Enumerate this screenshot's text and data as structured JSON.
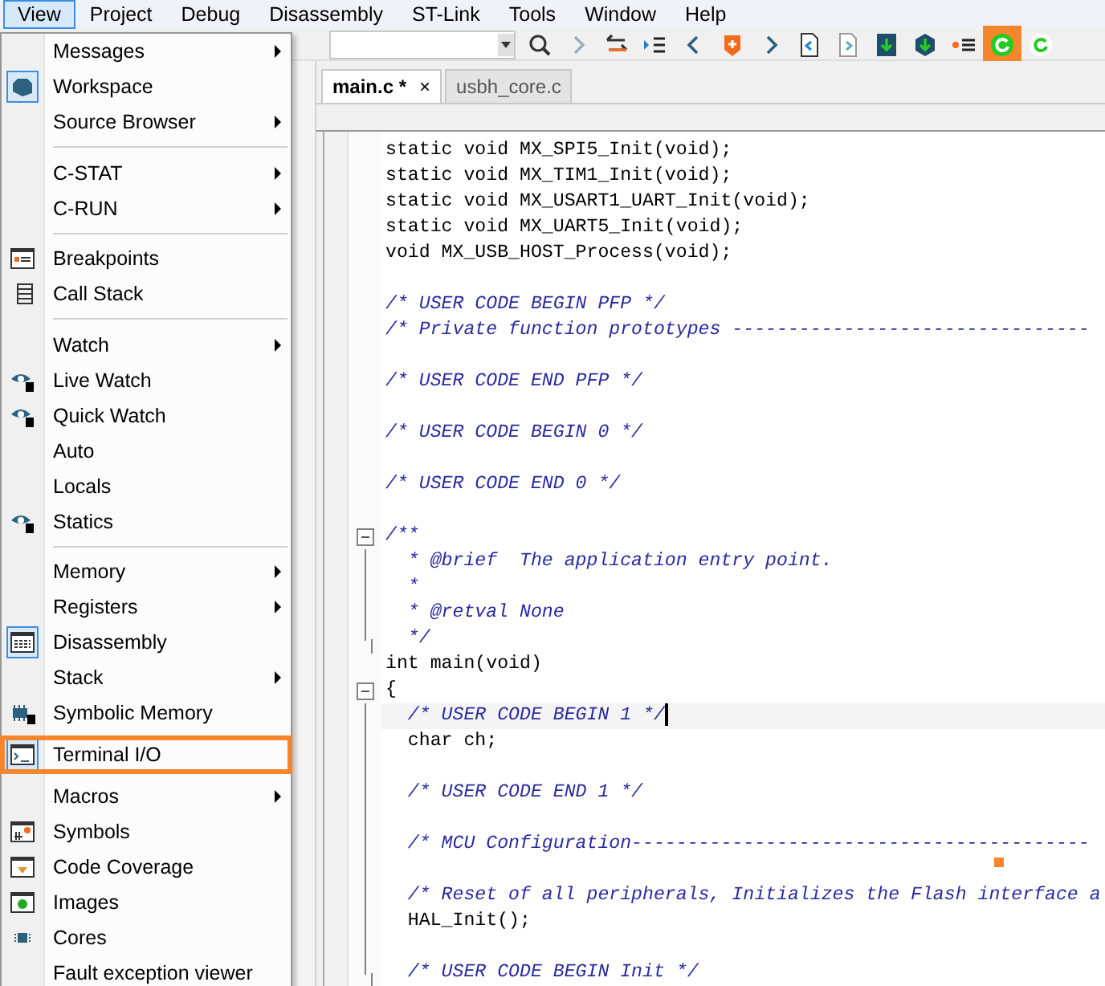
{
  "menubar": [
    {
      "label": "View",
      "selected": true
    },
    {
      "label": "Project",
      "selected": false
    },
    {
      "label": "Debug",
      "selected": false
    },
    {
      "label": "Disassembly",
      "selected": false
    },
    {
      "label": "ST-Link",
      "selected": false
    },
    {
      "label": "Tools",
      "selected": false
    },
    {
      "label": "Window",
      "selected": false
    },
    {
      "label": "Help",
      "selected": false
    }
  ],
  "toolbar": {
    "buttons": [
      {
        "highlighted": false
      },
      {
        "highlighted": false
      },
      {
        "highlighted": false
      },
      {
        "highlighted": false
      },
      {
        "highlighted": false
      },
      {
        "highlighted": false
      },
      {
        "highlighted": false
      },
      {
        "highlighted": false
      },
      {
        "highlighted": false
      },
      {
        "highlighted": false
      },
      {
        "highlighted": false
      },
      {
        "highlighted": false
      },
      {
        "highlighted": true
      },
      {
        "highlighted": false
      }
    ]
  },
  "tabs": [
    {
      "label": "main.c *",
      "selected": true,
      "close": "×"
    },
    {
      "label": "usbh_core.c",
      "selected": false
    }
  ],
  "code": [
    {
      "text": "static void MX_SPI5_Init(void);",
      "kind": "code",
      "current": false
    },
    {
      "text": "static void MX_TIM1_Init(void);",
      "kind": "code",
      "current": false
    },
    {
      "text": "static void MX_USART1_UART_Init(void);",
      "kind": "code",
      "current": false
    },
    {
      "text": "static void MX_UART5_Init(void);",
      "kind": "code",
      "current": false
    },
    {
      "text": "void MX_USB_HOST_Process(void);",
      "kind": "code",
      "current": false
    },
    {
      "kind": "blank"
    },
    {
      "text": "/* USER CODE BEGIN PFP */",
      "kind": "comment",
      "current": false
    },
    {
      "text": "/* Private function prototypes --------------------------------",
      "kind": "comment",
      "current": false
    },
    {
      "kind": "blank"
    },
    {
      "text": "/* USER CODE END PFP */",
      "kind": "comment",
      "current": false
    },
    {
      "kind": "blank"
    },
    {
      "text": "/* USER CODE BEGIN 0 */",
      "kind": "comment",
      "current": false
    },
    {
      "kind": "blank"
    },
    {
      "text": "/* USER CODE END 0 */",
      "kind": "comment",
      "current": false
    },
    {
      "kind": "blank"
    },
    {
      "text": "/**",
      "kind": "comment",
      "current": false,
      "children": [
        {
          "text": "  * @brief  The application entry point.",
          "kind": "comment",
          "current": false
        },
        {
          "text": "  *",
          "kind": "comment",
          "current": false
        },
        {
          "text": "  * @retval None",
          "kind": "comment",
          "current": false
        },
        {
          "text": "  */",
          "kind": "comment",
          "current": false
        }
      ]
    },
    {
      "text": "int main(void)",
      "kind": "code",
      "current": false
    },
    {
      "text": "{",
      "kind": "code",
      "current": false,
      "children": [
        {
          "text": "  /* USER CODE BEGIN 1 */",
          "kind": "comment",
          "current": true
        },
        {
          "text": "  char ch;",
          "kind": "code",
          "current": false
        },
        {
          "kind": "blank"
        },
        {
          "text": "  /* USER CODE END 1 */",
          "kind": "comment",
          "current": false
        },
        {
          "kind": "blank"
        },
        {
          "text": "  /* MCU Configuration-----------------------------------------",
          "kind": "comment",
          "current": false
        },
        {
          "kind": "blank"
        },
        {
          "text": "  /* Reset of all peripherals, Initializes the Flash interface a",
          "kind": "comment",
          "current": false
        },
        {
          "text": "  HAL_Init();",
          "kind": "code",
          "current": false
        },
        {
          "kind": "blank"
        },
        {
          "text": "  /* USER CODE BEGIN Init */",
          "kind": "comment",
          "current": false
        }
      ]
    }
  ],
  "menu": [
    {
      "kind": "item",
      "label": "Messages",
      "submenu": true,
      "checked": false,
      "highlighted": false
    },
    {
      "kind": "item",
      "label": "Workspace",
      "submenu": false,
      "checked": true,
      "highlighted": false
    },
    {
      "kind": "item",
      "label": "Source Browser",
      "submenu": true,
      "checked": false,
      "highlighted": false
    },
    {
      "kind": "separator"
    },
    {
      "kind": "item",
      "label": "C-STAT",
      "submenu": true,
      "checked": false,
      "highlighted": false
    },
    {
      "kind": "item",
      "label": "C-RUN",
      "submenu": true,
      "checked": false,
      "highlighted": false
    },
    {
      "kind": "separator"
    },
    {
      "kind": "item",
      "label": "Breakpoints",
      "submenu": false,
      "checked": false,
      "highlighted": false
    },
    {
      "kind": "item",
      "label": "Call Stack",
      "submenu": false,
      "checked": false,
      "highlighted": false
    },
    {
      "kind": "separator"
    },
    {
      "kind": "item",
      "label": "Watch",
      "submenu": true,
      "checked": false,
      "highlighted": false
    },
    {
      "kind": "item",
      "label": "Live Watch",
      "submenu": false,
      "checked": false,
      "highlighted": false
    },
    {
      "kind": "item",
      "label": "Quick Watch",
      "submenu": false,
      "checked": false,
      "highlighted": false
    },
    {
      "kind": "item",
      "label": "Auto",
      "submenu": false,
      "checked": false,
      "highlighted": false
    },
    {
      "kind": "item",
      "label": "Locals",
      "submenu": false,
      "checked": false,
      "highlighted": false
    },
    {
      "kind": "item",
      "label": "Statics",
      "submenu": false,
      "checked": false,
      "highlighted": false
    },
    {
      "kind": "separator"
    },
    {
      "kind": "item",
      "label": "Memory",
      "submenu": true,
      "checked": false,
      "highlighted": false
    },
    {
      "kind": "item",
      "label": "Registers",
      "submenu": true,
      "checked": false,
      "highlighted": false
    },
    {
      "kind": "item",
      "label": "Disassembly",
      "submenu": false,
      "checked": true,
      "highlighted": false
    },
    {
      "kind": "item",
      "label": "Stack",
      "submenu": true,
      "checked": false,
      "highlighted": false
    },
    {
      "kind": "item",
      "label": "Symbolic Memory",
      "submenu": false,
      "checked": false,
      "highlighted": false
    },
    {
      "kind": "item",
      "label": "Terminal I/O",
      "submenu": false,
      "checked": true,
      "highlighted": true
    },
    {
      "kind": "item",
      "label": "Macros",
      "submenu": true,
      "checked": false,
      "highlighted": false
    },
    {
      "kind": "item",
      "label": "Symbols",
      "submenu": false,
      "checked": false,
      "highlighted": false
    },
    {
      "kind": "item",
      "label": "Code Coverage",
      "submenu": false,
      "checked": false,
      "highlighted": false
    },
    {
      "kind": "item",
      "label": "Images",
      "submenu": false,
      "checked": false,
      "highlighted": false
    },
    {
      "kind": "item",
      "label": "Cores",
      "submenu": false,
      "checked": false,
      "highlighted": false
    },
    {
      "kind": "item",
      "label": "Fault exception viewer",
      "submenu": false,
      "checked": false,
      "highlighted": false
    }
  ]
}
